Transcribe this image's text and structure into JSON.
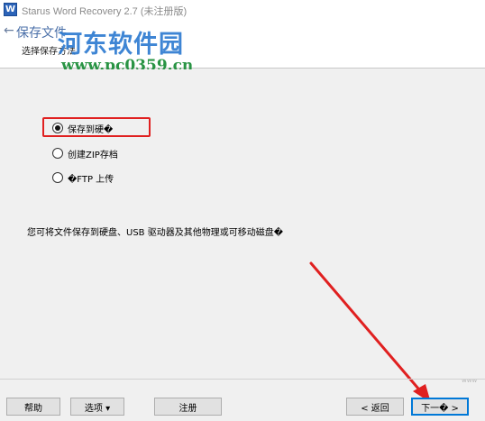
{
  "window": {
    "title": "Starus Word Recovery 2.7 (未注册版)",
    "icon_glyph": "W"
  },
  "header": {
    "back_glyph": "←",
    "title": "保存文件",
    "subtitle": "选择保存方法"
  },
  "watermark": {
    "logo": "河东软件园",
    "url": "www.pc0359.cn",
    "corner": "www"
  },
  "options": [
    {
      "label": "保存到硬�",
      "checked": true
    },
    {
      "label": "创建ZIP存档",
      "checked": false
    },
    {
      "label": "�FTP 上传",
      "checked": false
    }
  ],
  "info_text": "您可将文件保存到硬盘、USB 驱动器及其他物理或可移动磁盘�",
  "footer": {
    "help": "帮助",
    "options": "选项 ▾",
    "register": "注册",
    "back": "< 返回",
    "next": "下一� >"
  },
  "colors": {
    "highlight": "#e02020",
    "arrow": "#e02020",
    "accent": "#0078d7"
  }
}
